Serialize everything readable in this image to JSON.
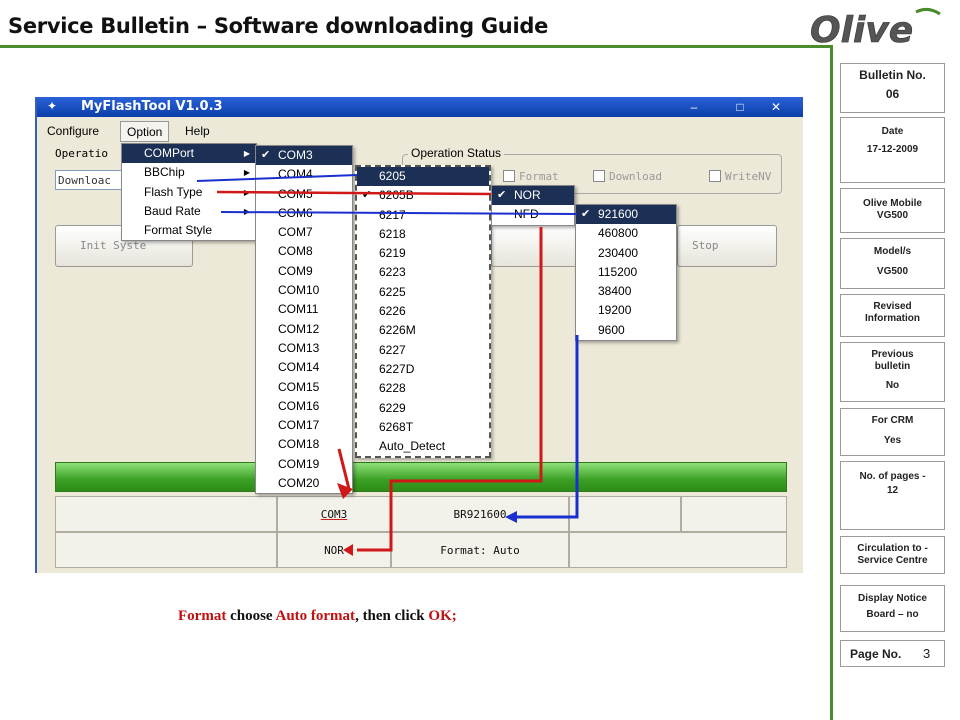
{
  "header": {
    "title": "Service Bulletin – Software downloading Guide",
    "logo_text": "Olive"
  },
  "side": {
    "bulletin_label": "Bulletin No.",
    "bulletin_value": "06",
    "date_label": "Date",
    "date_value": "17-12-2009",
    "product_l1": "Olive Mobile",
    "product_l2": "VG500",
    "model_label": "Model/s",
    "model_value": "VG500",
    "revised_l1": "Revised",
    "revised_l2": "Information",
    "prev_l1": "Previous",
    "prev_l2": "bulletin",
    "prev_value": "No",
    "crm_label": "For CRM",
    "crm_value": "Yes",
    "pages_l1": "No. of pages -",
    "pages_l2": "12",
    "circ_l1": "Circulation to -",
    "circ_l2": "Service Centre",
    "notice_l1": "Display Notice",
    "notice_l2": "Board – no",
    "page_label": "Page No.",
    "page_value": "3"
  },
  "app": {
    "title": "MyFlashTool V1.0.3",
    "menu": [
      "Configure",
      "Option",
      "Help"
    ],
    "option_menu": [
      "COMPort",
      "BBChip",
      "Flash Type",
      "Baud Rate",
      "Format Style"
    ],
    "com_ports": [
      "COM3",
      "COM4",
      "COM5",
      "COM6",
      "COM7",
      "COM8",
      "COM9",
      "COM10",
      "COM11",
      "COM12",
      "COM13",
      "COM14",
      "COM15",
      "COM16",
      "COM17",
      "COM18",
      "COM19",
      "COM20"
    ],
    "bbchips": [
      "6205",
      "6205B",
      "6217",
      "6218",
      "6219",
      "6223",
      "6225",
      "6226",
      "6226M",
      "6227",
      "6227D",
      "6228",
      "6229",
      "6268T",
      "Auto_Detect"
    ],
    "flash_types": [
      "NOR",
      "NFD"
    ],
    "baud_rates": [
      "921600",
      "460800",
      "230400",
      "115200",
      "38400",
      "19200",
      "9600"
    ],
    "operation_label": "Operatio",
    "download_field": "Downloac",
    "operation_status": "Operation Status",
    "checkbox_format": "Format",
    "checkbox_download": "Download",
    "checkbox_writenv": "WriteNV",
    "init_button": "Init Syste",
    "stop_button": "Stop",
    "status_com": "COM3",
    "status_baud": "BR921600",
    "status_flash": "NOR",
    "status_format": "Format: Auto"
  },
  "caption": {
    "w1": "Format",
    "w2": " choose ",
    "w3": "Auto format",
    "w4": ", then click ",
    "w5": "OK;"
  }
}
